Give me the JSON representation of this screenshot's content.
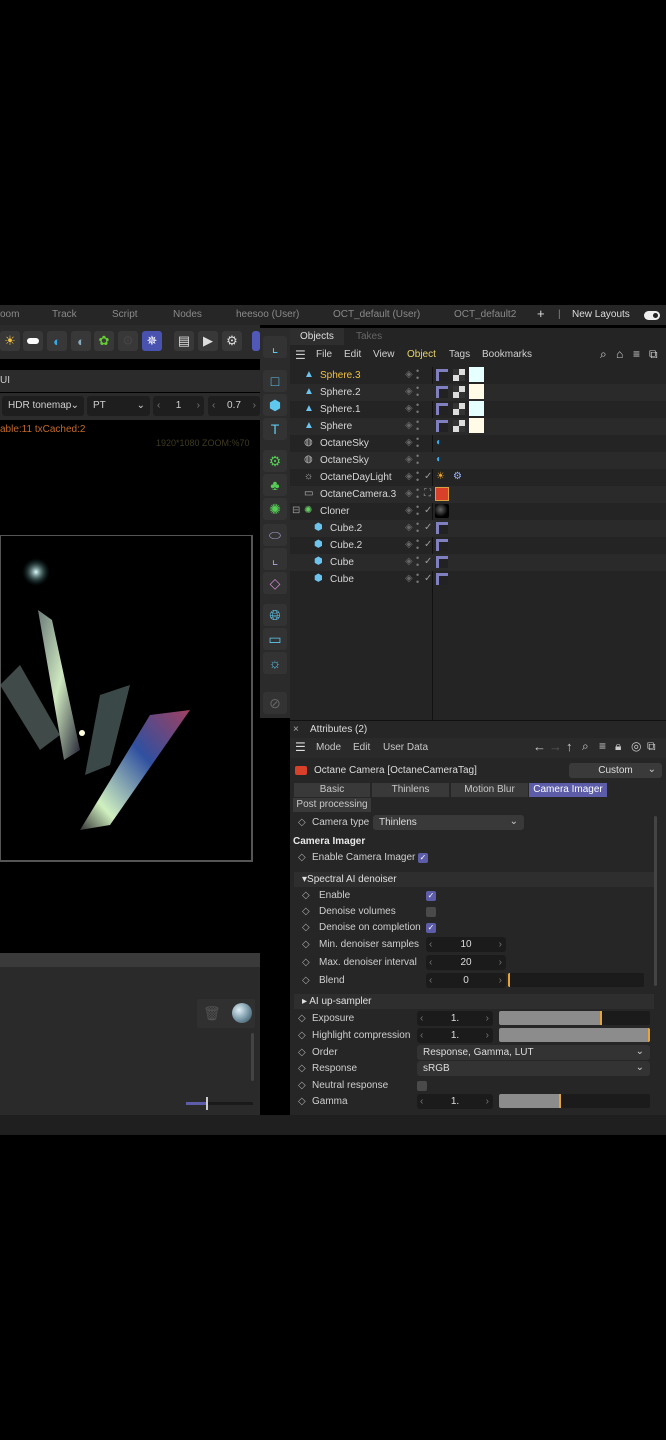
{
  "menubar": {
    "items": [
      "oom",
      "Track",
      "Script",
      "Nodes",
      "heesoo (User)",
      "OCT_default (User)",
      "OCT_default2",
      "+",
      "|",
      "New Layouts"
    ],
    "toggle_on": true
  },
  "viewport": {
    "panel_label": "UI",
    "tonemap": "HDR tonemap",
    "kernel": "PT",
    "value1": "1",
    "value2": "0.7",
    "status": "able:11 txCached:2",
    "resolution": "1920*1080 ZOOM:%70"
  },
  "objects": {
    "tabs": [
      "Objects",
      "Takes"
    ],
    "menu": [
      "File",
      "Edit",
      "View",
      "Object",
      "Tags",
      "Bookmarks"
    ],
    "rows": [
      {
        "name": "Sphere.3",
        "icon": "sphere-emitter-icon",
        "selected": true
      },
      {
        "name": "Sphere.2",
        "icon": "sphere-emitter-icon"
      },
      {
        "name": "Sphere.1",
        "icon": "sphere-emitter-icon"
      },
      {
        "name": "Sphere",
        "icon": "sphere-emitter-icon"
      },
      {
        "name": "OctaneSky",
        "icon": "globe-icon"
      },
      {
        "name": "OctaneSky",
        "icon": "globe-icon"
      },
      {
        "name": "OctaneDayLight",
        "icon": "sun-icon"
      },
      {
        "name": "OctaneCamera.3",
        "icon": "camera-icon"
      },
      {
        "name": "Cloner",
        "icon": "cloner-icon"
      },
      {
        "name": "Cube.2",
        "icon": "cube-icon"
      },
      {
        "name": "Cube.2",
        "icon": "cube-icon"
      },
      {
        "name": "Cube",
        "icon": "cube-icon"
      },
      {
        "name": "Cube",
        "icon": "cube-icon"
      }
    ]
  },
  "attributes": {
    "title": "Attributes (2)",
    "menu": [
      "Mode",
      "Edit",
      "User Data"
    ],
    "object": "Octane Camera [OctaneCameraTag]",
    "preset": "Custom",
    "tabs": [
      "Basic",
      "Thinlens",
      "Motion Blur",
      "Camera Imager",
      "Post processing"
    ],
    "active_tab": "Camera Imager",
    "camera_type_label": "Camera type",
    "camera_type": "Thinlens",
    "section": "Camera Imager",
    "enable_imager_label": "Enable Camera Imager",
    "denoiser": {
      "title": "Spectral AI denoiser",
      "enable": "Enable",
      "denoise_volumes": "Denoise volumes",
      "denoise_completion": "Denoise on completion",
      "min_samples_label": "Min. denoiser samples",
      "min_samples": "10",
      "max_interval_label": "Max. denoiser interval",
      "max_interval": "20",
      "blend_label": "Blend",
      "blend": "0",
      "blend_fraction": 0
    },
    "upsampler": "AI up-sampler",
    "exposure_label": "Exposure",
    "exposure": "1.",
    "exposure_fraction": 0.68,
    "highlight_label": "Highlight compression",
    "highlight": "1.",
    "highlight_fraction": 1.0,
    "order_label": "Order",
    "order": "Response, Gamma, LUT",
    "response_label": "Response",
    "response": "sRGB",
    "neutral_label": "Neutral response",
    "gamma_label": "Gamma",
    "gamma": "1.",
    "gamma_fraction": 0.41
  },
  "colors": {
    "accent": "#5c5ca8",
    "selected_text": "#f0c040",
    "slider_marker": "#e5a53a"
  }
}
